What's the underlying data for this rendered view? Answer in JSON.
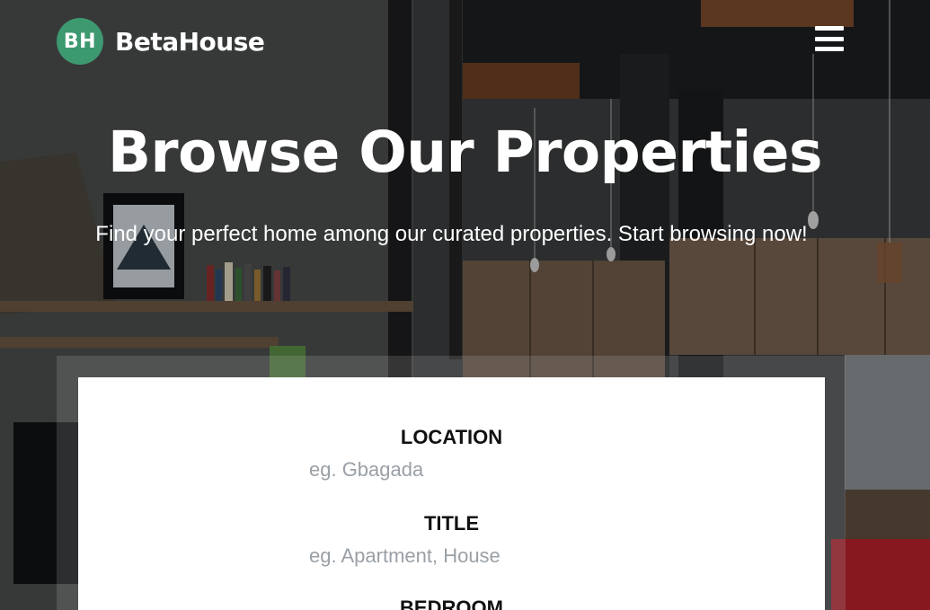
{
  "brand": {
    "badge": "BH",
    "name": "BetaHouse",
    "accent": "#3d9970"
  },
  "header": {
    "menu_icon": "hamburger-menu-icon"
  },
  "hero": {
    "title": "Browse Our Properties",
    "subtitle": "Find your perfect home among our curated properties. Start browsing now!"
  },
  "search": {
    "location": {
      "label": "LOCATION",
      "placeholder": "eg. Gbagada"
    },
    "title": {
      "label": "TITLE",
      "placeholder": "eg. Apartment, House"
    },
    "bedroom": {
      "label": "BEDROOM"
    }
  }
}
